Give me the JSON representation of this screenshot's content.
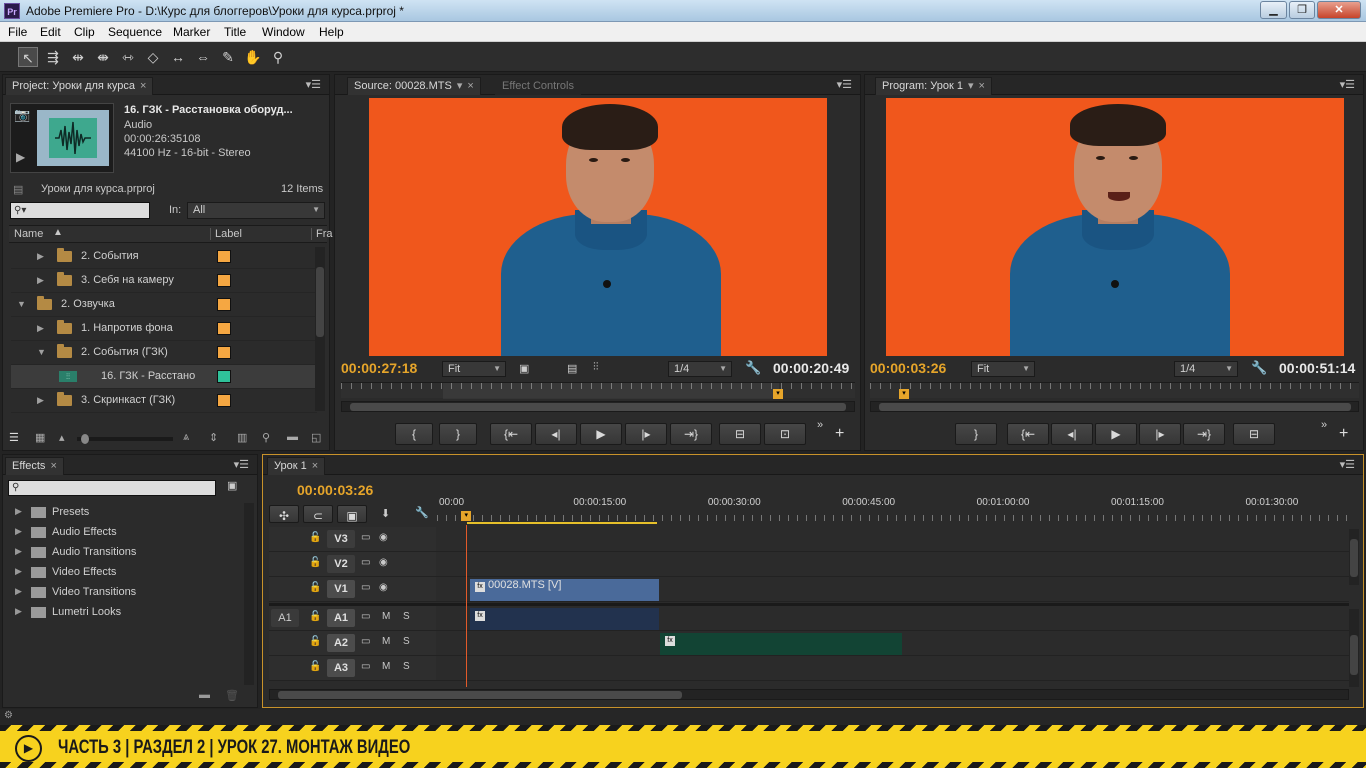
{
  "window": {
    "app_icon": "Pr",
    "title": "Adobe Premiere Pro - D:\\Курс для блоггеров\\Уроки для курса.prproj *",
    "buttons": [
      "minimize",
      "maximize",
      "close"
    ]
  },
  "menu": [
    "File",
    "Edit",
    "Clip",
    "Sequence",
    "Marker",
    "Title",
    "Window",
    "Help"
  ],
  "tools": [
    "selection-tool",
    "track-select-tool",
    "ripple-edit-tool",
    "rolling-edit-tool",
    "rate-stretch-tool",
    "razor-tool",
    "slip-tool",
    "slide-tool",
    "pen-tool",
    "hand-tool",
    "zoom-tool"
  ],
  "project": {
    "tab": "Project: Уроки для курса",
    "preview": {
      "name": "16. ГЗК - Расстановка оборуд...",
      "type": "Audio",
      "duration": "00:00:26:35108",
      "format": "44100 Hz - 16-bit - Stereo"
    },
    "file": "Уроки для курса.prproj",
    "count": "12 Items",
    "in_label": "In:",
    "in_value": "All",
    "columns": {
      "name": "Name",
      "label": "Label",
      "frame": "Fra"
    },
    "rows": [
      {
        "name": "2. События",
        "indent": 2,
        "expanded": false,
        "kind": "folder",
        "color": "#f5a742"
      },
      {
        "name": "3. Себя на камеру",
        "indent": 2,
        "expanded": false,
        "kind": "folder",
        "color": "#f5a742"
      },
      {
        "name": "2. Озвучка",
        "indent": 1,
        "expanded": true,
        "kind": "folder",
        "color": "#f5a742"
      },
      {
        "name": "1. Напротив фона",
        "indent": 2,
        "expanded": false,
        "kind": "folder",
        "color": "#f5a742"
      },
      {
        "name": "2. События (ГЗК)",
        "indent": 2,
        "expanded": true,
        "kind": "folder",
        "color": "#f5a742"
      },
      {
        "name": "16. ГЗК - Расстано",
        "indent": 3,
        "expanded": null,
        "kind": "audio",
        "color": "#2fc29a",
        "selected": true
      },
      {
        "name": "3. Скринкаст (ГЗК)",
        "indent": 2,
        "expanded": false,
        "kind": "folder",
        "color": "#f5a742"
      }
    ]
  },
  "source": {
    "tab": "Source: 00028.MTS",
    "tab2": "Effect Controls",
    "timecode": "00:00:27:18",
    "fit": "Fit",
    "quality": "1/4",
    "duration": "00:00:20:49"
  },
  "program": {
    "tab": "Program: Урок 1",
    "timecode": "00:00:03:26",
    "fit": "Fit",
    "quality": "1/4",
    "duration": "00:00:51:14"
  },
  "effects": {
    "tab": "Effects",
    "items": [
      "Presets",
      "Audio Effects",
      "Audio Transitions",
      "Video Effects",
      "Video Transitions",
      "Lumetri Looks"
    ]
  },
  "timeline": {
    "tab": "Урок 1",
    "timecode": "00:00:03:26",
    "ruler": [
      "00:00",
      "00:00:15:00",
      "00:00:30:00",
      "00:00:45:00",
      "00:01:00:00",
      "00:01:15:00",
      "00:01:30:00"
    ],
    "video_tracks": [
      "V3",
      "V2",
      "V1"
    ],
    "audio_tracks": [
      "A1",
      "A2",
      "A3"
    ],
    "source_patch": "A1",
    "mute": "M",
    "solo": "S",
    "clip_v1": "00028.MTS [V]",
    "playhead_seconds": 3.26,
    "visible_span_seconds": 102
  },
  "banner": {
    "text": "ЧАСТЬ 3 | РАЗДЕЛ 2 | УРОК 27. МОНТАЖ ВИДЕО",
    "colors": {
      "bg": "#f7d21e",
      "fg": "#1a1a1a"
    }
  },
  "colors": {
    "accent_timecode": "#e6a52a",
    "video_bg": "#f0571c",
    "audio_label": "#2fc29a",
    "folder_label": "#f5a742"
  }
}
